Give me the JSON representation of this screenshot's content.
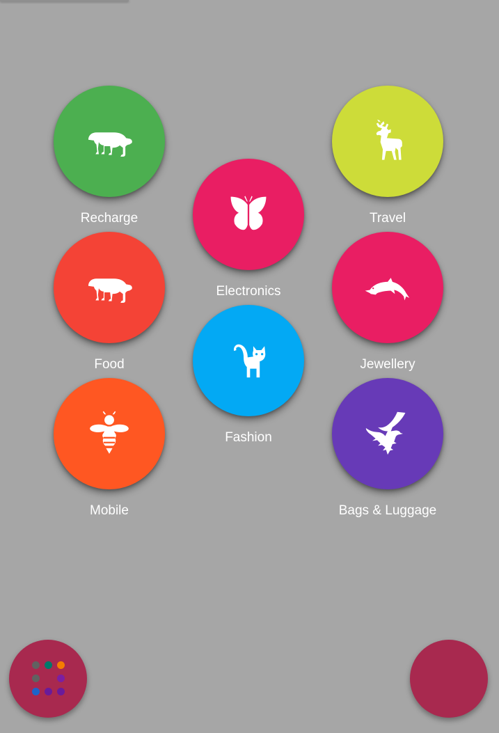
{
  "categories": [
    {
      "label": "Recharge",
      "color": "#4caf50",
      "icon": "polar-bear-icon"
    },
    {
      "label": "Electronics",
      "color": "#e91e63",
      "icon": "butterfly-icon"
    },
    {
      "label": "Travel",
      "color": "#cddc39",
      "icon": "deer-icon"
    },
    {
      "label": "Food",
      "color": "#f44336",
      "icon": "polar-bear-icon"
    },
    {
      "label": "Fashion",
      "color": "#03a9f4",
      "icon": "cat-icon"
    },
    {
      "label": "Jewellery",
      "color": "#e91e63",
      "icon": "dolphin-icon"
    },
    {
      "label": "Mobile",
      "color": "#ff5722",
      "icon": "bee-icon"
    },
    {
      "label": "Bags & Luggage",
      "color": "#673ab7",
      "icon": "eagle-icon"
    }
  ],
  "fab_left": {
    "icon": "color-palette-icon",
    "color": "#a8294f",
    "dot_colors": [
      "#616161",
      "#00796b",
      "#f57c00",
      "#616161",
      "",
      "#7b1fa2",
      "#1e63c9",
      "#6a1b9a",
      "#6a1b9a"
    ]
  },
  "fab_right": {
    "color": "#a8294f"
  }
}
